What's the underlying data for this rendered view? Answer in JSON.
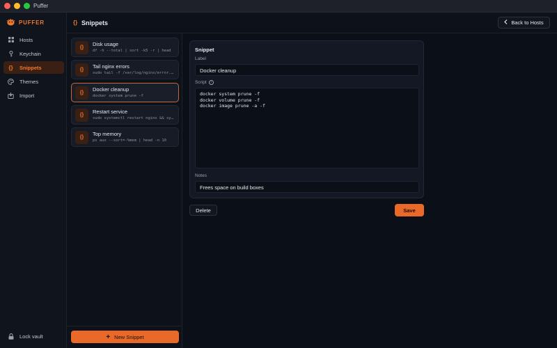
{
  "window": {
    "title": "Puffer"
  },
  "brand": {
    "name": "PUFFER",
    "accent": "#f07a2c"
  },
  "sidebar": {
    "items": [
      {
        "label": "Hosts",
        "icon": "grid-icon",
        "active": false
      },
      {
        "label": "Keychain",
        "icon": "key-icon",
        "active": false
      },
      {
        "label": "Snippets",
        "icon": "braces-icon",
        "active": true
      },
      {
        "label": "Themes",
        "icon": "palette-icon",
        "active": false
      },
      {
        "label": "Import",
        "icon": "import-icon",
        "active": false
      }
    ],
    "lock_label": "Lock vault"
  },
  "header": {
    "icon_text": "{}",
    "title": "Snippets",
    "back_label": "Back to Hosts"
  },
  "snippets": [
    {
      "badge": "{}",
      "name": "Disk usage",
      "command": "df -h --total | sort -k5 -r | head",
      "selected": false
    },
    {
      "badge": "{}",
      "name": "Tail nginx errors",
      "command": "sudo tail -f /var/log/nginx/error.log",
      "selected": false
    },
    {
      "badge": "{}",
      "name": "Docker cleanup",
      "command": "docker system prune -f",
      "selected": true
    },
    {
      "badge": "{}",
      "name": "Restart service",
      "command": "sudo systemctl restart nginx && systemctl status",
      "selected": false
    },
    {
      "badge": "{}",
      "name": "Top memory",
      "command": "ps aux --sort=-%mem | head -n 10",
      "selected": false
    }
  ],
  "new_snippet_label": "New Snippet",
  "editor": {
    "card_title": "Snippet",
    "label_field": {
      "label": "Label",
      "value": "Docker cleanup"
    },
    "script_field": {
      "label": "Script",
      "lines": [
        "docker system prune -f",
        "docker volume prune -f",
        "docker image prune -a -f"
      ]
    },
    "notes_field": {
      "label": "Notes",
      "value": "Frees space on build boxes"
    },
    "delete_label": "Delete",
    "save_label": "Save"
  }
}
